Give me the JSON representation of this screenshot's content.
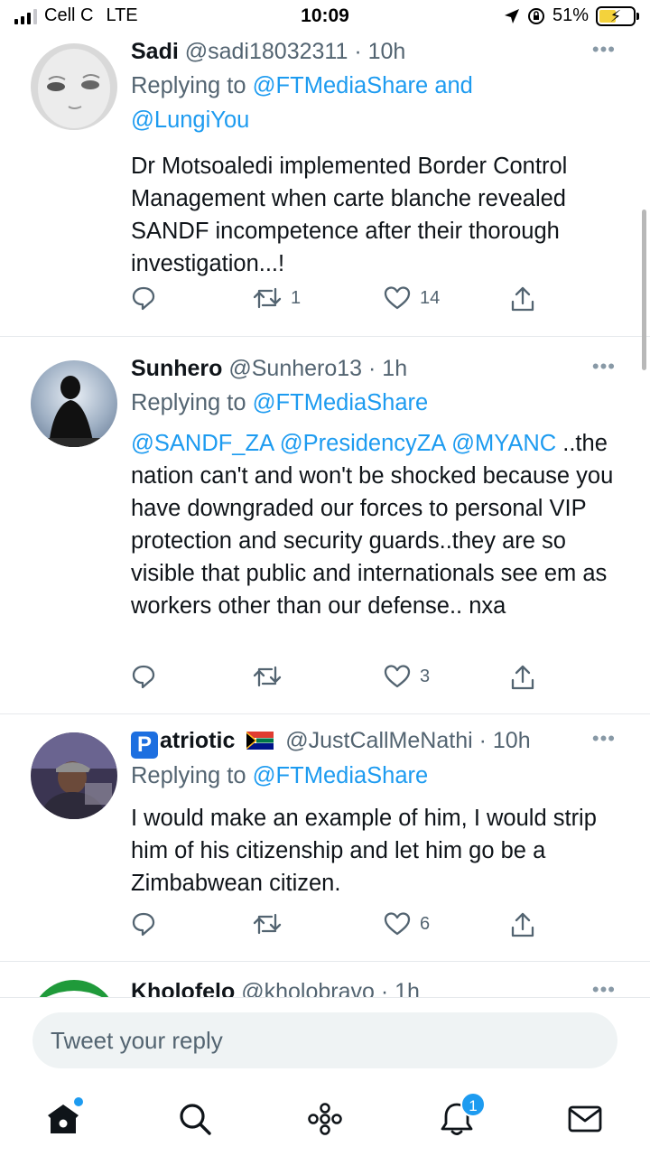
{
  "status_bar": {
    "carrier": "Cell C",
    "network": "LTE",
    "time": "10:09",
    "battery_percent": "51%",
    "battery_level": 0.51
  },
  "tweets": [
    {
      "name": "Sadi",
      "handle": "@sadi18032311",
      "time": "· 10h",
      "reply_prefix": "Replying to",
      "reply_to_1": "@FTMediaShare",
      "reply_joiner": "and",
      "reply_to_2": "@LungiYou",
      "text": "Dr Motsoaledi implemented Border Control Management when carte blanche revealed SANDF incompetence after their thorough investigation...!",
      "retweets": "1",
      "likes": "14"
    },
    {
      "name": "Sunhero",
      "handle": "@Sunhero13",
      "time": "· 1h",
      "reply_prefix": "Replying to",
      "reply_to_1": "@FTMediaShare",
      "mention_1": "@SANDF_ZA",
      "mention_2": "@PresidencyZA",
      "mention_3": "@MYANC",
      "text": "..the nation can't and won't be shocked because you have downgraded our forces to personal VIP protection and security guards..they are so visible that public and internationals see em as workers other than our defense.. nxa",
      "retweets": "",
      "likes": "3"
    },
    {
      "name_badge": "P",
      "name": "atriotic",
      "handle": "@JustCallMeNathi",
      "time": "· 10h",
      "reply_prefix": "Replying to",
      "reply_to_1": "@FTMediaShare",
      "text": "I would make an example of him, I would strip him of his citizenship and let him go be a Zimbabwean citizen.",
      "retweets": "",
      "likes": "6"
    },
    {
      "name": "Kholofelo",
      "handle": "@kholobravo",
      "time": "· 1h"
    }
  ],
  "composer": {
    "placeholder": "Tweet your reply"
  },
  "tabbar": {
    "notifications_count": "1"
  },
  "colors": {
    "accent": "#1d9bf0",
    "secondary_text": "#536471"
  }
}
